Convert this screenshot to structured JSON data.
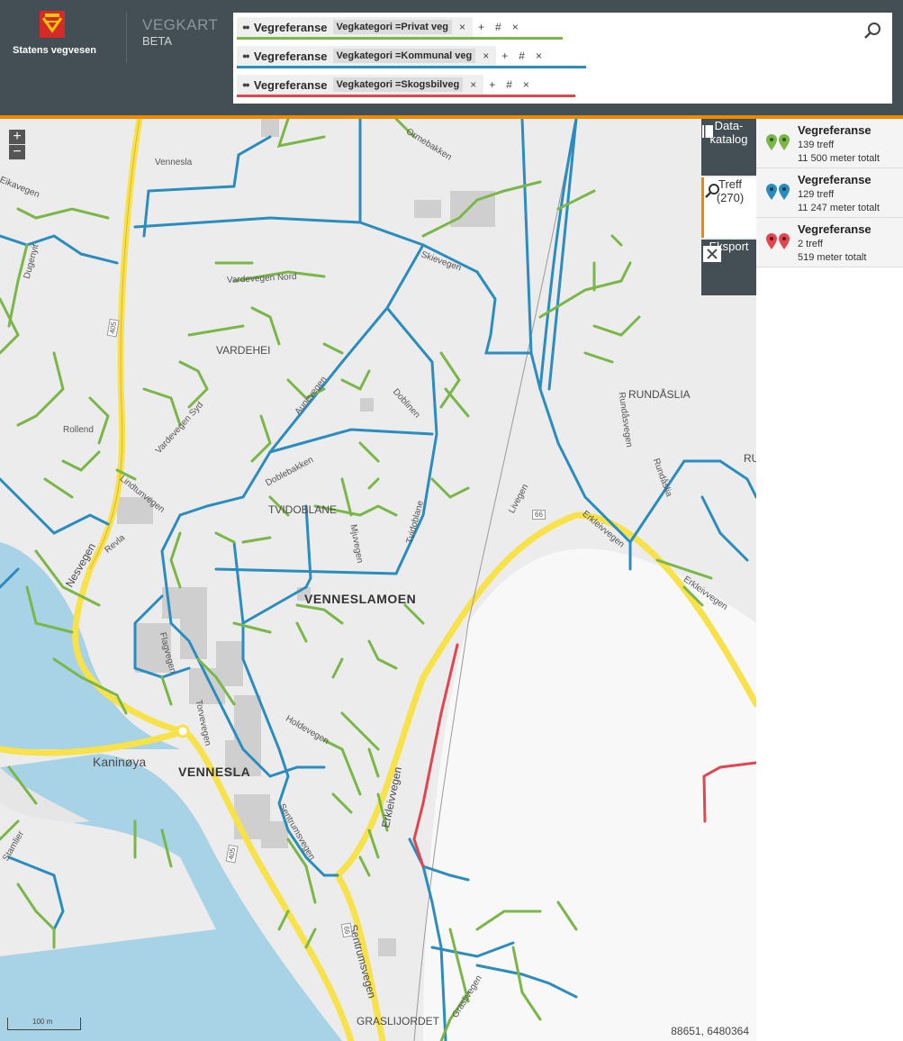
{
  "header": {
    "org_name": "Statens vegvesen",
    "app_title": "VEGKART",
    "app_subtitle": "BETA"
  },
  "colors": {
    "header_bg": "#444f55",
    "accent": "#ed8b00",
    "privat": "#7ab648",
    "kommunal": "#2b8cbe",
    "skogsbilveg": "#e0464f",
    "national_road": "#f7e24b"
  },
  "filters": [
    {
      "name": "Vegreferanse",
      "condition": "Vegkategori =Privat veg",
      "color": "#7ab648"
    },
    {
      "name": "Vegreferanse",
      "condition": "Vegkategori =Kommunal veg",
      "color": "#2b8cbe"
    },
    {
      "name": "Vegreferanse",
      "condition": "Vegkategori =Skogsbilveg",
      "color": "#e0464f"
    }
  ],
  "filter_controls": {
    "remove": "×",
    "add": "+",
    "count": "#",
    "close": "×"
  },
  "toolbar": {
    "datakatalog": "Data-\nkatalog",
    "treff": "Treff",
    "treff_count": "(270)",
    "eksport": "Eksport"
  },
  "results": [
    {
      "title": "Vegreferanse",
      "count": "139 treff",
      "length": "11 500 meter totalt",
      "color": "#7ab648"
    },
    {
      "title": "Vegreferanse",
      "count": "129 treff",
      "length": "11 247 meter totalt",
      "color": "#2b8cbe"
    },
    {
      "title": "Vegreferanse",
      "count": "2 treff",
      "length": "519 meter totalt",
      "color": "#e0464f"
    }
  ],
  "map": {
    "zoom_in": "+",
    "zoom_out": "−",
    "scale": "100 m",
    "coordinates": "88651, 6480364",
    "place_labels": {
      "venneslamoen": "VENNESLAMOEN",
      "vennesla": "VENNESLA",
      "vardehei": "VARDEHEI",
      "tvidoblane": "TVIDOBLANE",
      "rundaslia": "RUNDÅSLIA",
      "kaninoya": "Kaninøya",
      "graslijordet": "GRASLIJORDET",
      "vennesla_small": "Vennesla",
      "ru": "RU"
    },
    "road_labels": {
      "vardevegen_nord": "Vardevegen Nord",
      "vardevegen_syd": "Vardevegen Syd",
      "skievegen": "Skievegen",
      "aunevegen": "Aunevegen",
      "doblebakken": "Doblebakken",
      "doblebakken2": "Dobleb.akken",
      "doblinen": "Doblinen",
      "rollend": "Rollend",
      "tvidoblane_v": "Tvidoblane",
      "mjuvegen": "Mjuvegen",
      "holdevegen": "Holdevegen",
      "torvevegen": "Torvevegen",
      "flagvegen": "Flagvegen",
      "sentrumsvegen": "Sentrumsvegen",
      "sentrumsvegen2": "Sentrumsvegen",
      "erkleivvegen": "Erkleivvegen",
      "erkleivvegen2": "Erkleivvegen",
      "erkleivvegen3": "Erkleivvegen",
      "nesvegen": "Nesvegen",
      "revla": "Revla",
      "lindtunvegen": "Lindtunvegen",
      "rundasvegen": "Rundåsvegen",
      "rundaslia_v": "Rundåslia",
      "livegen": "Livegen",
      "stamlier": "Stamlier",
      "eikavegen": "Eikavegen",
      "grasliegen": "Graslivegen",
      "dugenyit": "Dugenyit",
      "ormebakken": "Ormebakken",
      "road405": "405",
      "road405b": "405",
      "road66": "66",
      "road66b": "66"
    }
  }
}
